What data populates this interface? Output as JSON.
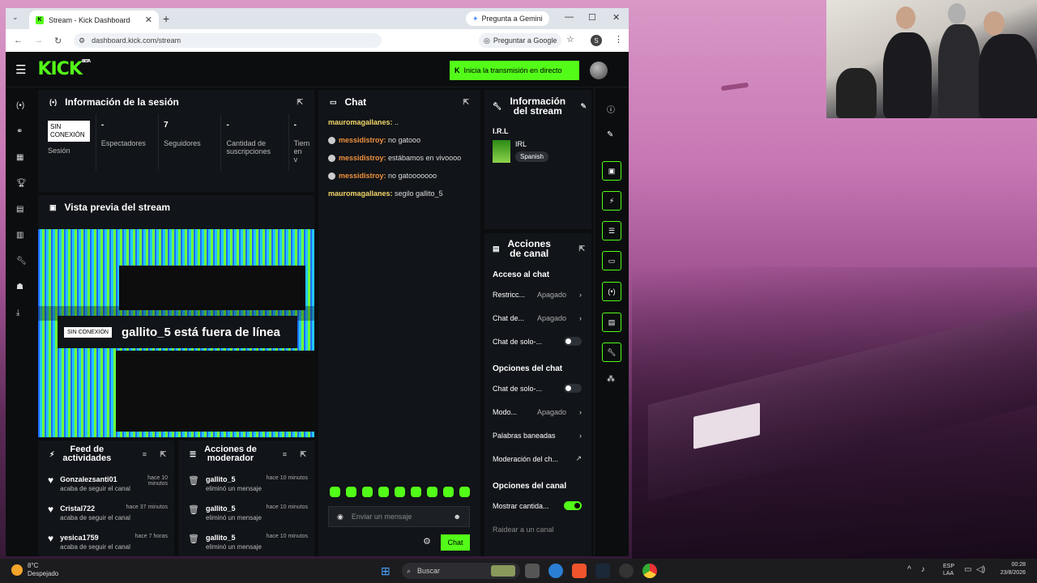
{
  "browser": {
    "tab_title": "Stream - Kick Dashboard",
    "gemini_label": "Pregunta a Gemini",
    "url": "dashboard.kick.com/stream",
    "ask_google": "Preguntar a Google",
    "profile_initial": "S"
  },
  "kick": {
    "logo": "KICK",
    "beta": "BETA",
    "go_live": "Inicia la transmisión en directo"
  },
  "session": {
    "title": "Información de la sesión",
    "status_badge": "SIN CONEXIÓN",
    "status_label": "Sesión",
    "stats": [
      {
        "value": "-",
        "label": "Espectadores"
      },
      {
        "value": "7",
        "label": "Seguidores"
      },
      {
        "value": "-",
        "label": "Cantidad de suscripciones"
      },
      {
        "value": "-",
        "label": "Tiem en v"
      }
    ]
  },
  "preview": {
    "title": "Vista previa del stream",
    "badge": "SIN CONEXIÓN",
    "offline_text": "gallito_5 está fuera de línea"
  },
  "chat": {
    "title": "Chat",
    "messages": [
      {
        "user": "mauromagallanes:",
        "text": " ..",
        "badge": false
      },
      {
        "user": "messidistroy:",
        "text": " no gatooo",
        "badge": true
      },
      {
        "user": "messidistroy:",
        "text": " estábamos en vivoooo",
        "badge": true
      },
      {
        "user": "messidistroy:",
        "text": " no gatooooooo",
        "badge": true
      },
      {
        "user": "mauromagallanes:",
        "text": " segilo gallito_5",
        "badge": false
      }
    ],
    "input_placeholder": "Enviar un mensaje",
    "send_label": "Chat"
  },
  "stream_info": {
    "title_l1": "Información",
    "title_l2": "del stream",
    "stream_title": "I.R.L",
    "category": "IRL",
    "language": "Spanish"
  },
  "channel_actions": {
    "title_l1": "Acciones",
    "title_l2": "de canal",
    "chat_access": "Acceso al chat",
    "rows_access": [
      {
        "label": "Restricc...",
        "value": "Apagado",
        "type": "chevron"
      },
      {
        "label": "Chat de...",
        "value": "Apagado",
        "type": "chevron"
      },
      {
        "label": "Chat de solo-...",
        "value": "",
        "type": "toggle-off"
      }
    ],
    "chat_options": "Opciones del chat",
    "rows_options": [
      {
        "label": "Chat de solo-...",
        "value": "",
        "type": "toggle-off"
      },
      {
        "label": "Modo...",
        "value": "Apagado",
        "type": "chevron"
      },
      {
        "label": "Palabras baneadas",
        "value": "",
        "type": "chevron"
      },
      {
        "label": "Moderación del ch...",
        "value": "",
        "type": "external"
      }
    ],
    "channel_options": "Opciones del canal",
    "rows_channel": [
      {
        "label": "Mostrar cantida...",
        "value": "",
        "type": "toggle-on"
      }
    ],
    "raid": "Raidear a un canal"
  },
  "activity_feed": {
    "title_l1": "Feed de",
    "title_l2": "actividades",
    "items": [
      {
        "name": "Gonzalezsanti01",
        "action": "acaba de seguir el canal",
        "time": "hace 10 minutos"
      },
      {
        "name": "Cristal722",
        "action": "acaba de seguir el canal",
        "time": "hace 37 minutos"
      },
      {
        "name": "yesica1759",
        "action": "acaba de seguir el canal",
        "time": "hace 7 horas"
      }
    ]
  },
  "mod_actions": {
    "title_l1": "Acciones de",
    "title_l2": "moderador",
    "items": [
      {
        "name": "gallito_5",
        "action": "eliminó un mensaje",
        "time": "hace 10 minutos"
      },
      {
        "name": "gallito_5",
        "action": "eliminó un mensaje",
        "time": "hace 10 minutos"
      },
      {
        "name": "gallito_5",
        "action": "eliminó un mensaje",
        "time": "hace 10 minutos"
      }
    ]
  },
  "taskbar": {
    "temp": "8°C",
    "weather": "Despejado",
    "search": "Buscar",
    "lang1": "ESP",
    "lang2": "LAA",
    "time": "00:28",
    "date": "23/8/2026"
  },
  "colors": {
    "accent": "#53fc18",
    "panel": "#111418"
  }
}
